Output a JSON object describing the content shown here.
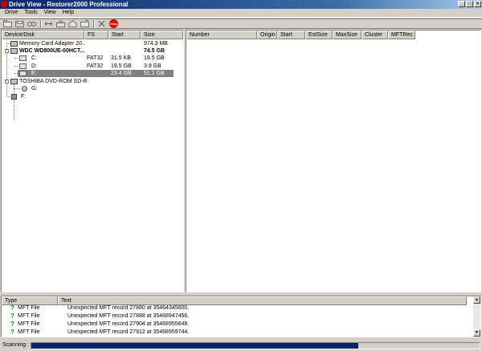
{
  "window": {
    "title": "Drive View - Restorer2000 Professional"
  },
  "menu": [
    "Drive",
    "Tools",
    "View",
    "Help"
  ],
  "toolbar": {
    "icons": [
      "open-icon",
      "save-icon",
      "find-icon",
      "swap-icon",
      "up-folder-icon",
      "home-icon",
      "folder-icon",
      "cut-icon",
      "stop-icon"
    ],
    "stop_label": "Stop"
  },
  "left_table": {
    "columns": [
      "Device/Disk",
      "FS",
      "Start",
      "Size"
    ],
    "rows": [
      {
        "name": "Memory Card Adapter 20...",
        "fs": "",
        "start": "",
        "size": "974.3 MB",
        "level": 1,
        "icon": "disk"
      },
      {
        "name": "WDC WD800UE-00HCT...",
        "fs": "",
        "start": "",
        "size": "74.5 GB",
        "level": 1,
        "icon": "disk",
        "bold": true
      },
      {
        "name": "C:",
        "fs": "FAT32",
        "start": "31.5 KB",
        "size": "19.5 GB",
        "level": 2,
        "icon": "drive"
      },
      {
        "name": "D:",
        "fs": "FAT32",
        "start": "19.5 GB",
        "size": "3.9 GB",
        "level": 2,
        "icon": "drive"
      },
      {
        "name": "E:",
        "fs": "",
        "start": "23.4 GB",
        "size": "51.1 GB",
        "level": 2,
        "icon": "drive",
        "selected": true
      },
      {
        "name": "TOSHIBA DVD-ROM SD-R...",
        "fs": "",
        "start": "",
        "size": "",
        "level": 1,
        "icon": "disk"
      },
      {
        "name": "G:",
        "fs": "",
        "start": "",
        "size": "",
        "level": 2,
        "icon": "cd"
      },
      {
        "name": "F:",
        "fs": "",
        "start": "",
        "size": "",
        "level": 1,
        "icon": "floppy"
      }
    ]
  },
  "right_table": {
    "columns": [
      "Number",
      "Origin",
      "Start",
      "EstSize",
      "MaxSize",
      "Cluster",
      "MFTRec"
    ]
  },
  "log": {
    "columns": [
      "Type",
      "Text"
    ],
    "rows": [
      {
        "type": "MFT File",
        "text": "Unexpected MFT record 27880 at 35464345600."
      },
      {
        "type": "MFT File",
        "text": "Unexpected MFT record 27888 at 35468947456."
      },
      {
        "type": "MFT File",
        "text": "Unexpected MFT record 27904 at 35468955648."
      },
      {
        "type": "MFT File",
        "text": "Unexpected MFT record 27912 at 35468959744."
      }
    ]
  },
  "status": {
    "label": "Scanning :",
    "progress": 0.73
  },
  "colors": {
    "title_start": "#0a246a",
    "selection": "#808080",
    "progress": "#0a246a",
    "question": "#1a8a1a"
  }
}
